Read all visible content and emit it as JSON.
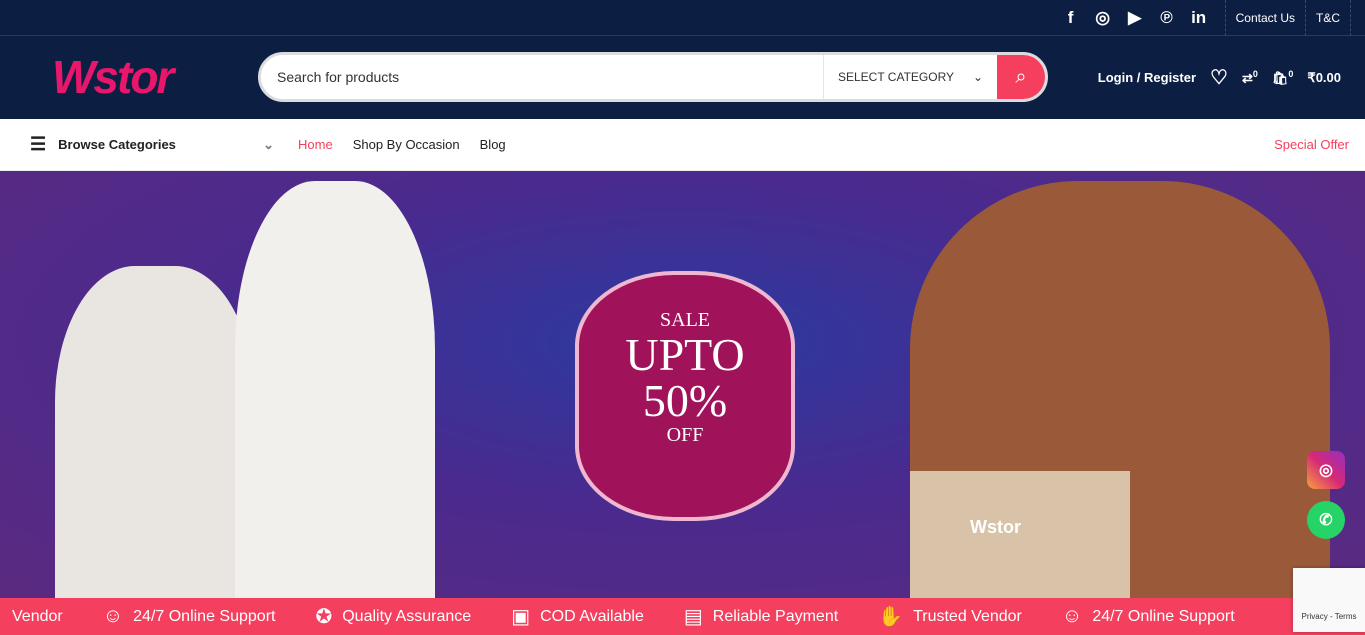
{
  "topbar": {
    "social": [
      "facebook-icon",
      "instagram-icon",
      "youtube-icon",
      "pinterest-icon",
      "linkedin-icon"
    ],
    "links": [
      "Contact Us",
      "T&C"
    ]
  },
  "header": {
    "logo": "Wstor",
    "search_placeholder": "Search for products",
    "category": "SELECT CATEGORY",
    "login": "Login / Register",
    "compare_count": "0",
    "cart_count": "0",
    "cart_total": "₹0.00"
  },
  "nav": {
    "browse": "Browse Categories",
    "items": [
      "Home",
      "Shop By Occasion",
      "Blog"
    ],
    "special": "Special Offer"
  },
  "hero": {
    "sale": "SALE",
    "upto": "UPTO",
    "percent": "50%",
    "off": "OFF",
    "bag_logo": "Wstor"
  },
  "features": [
    "Vendor",
    "24/7 Online Support",
    "Quality Assurance",
    "COD Available",
    "Reliable Payment",
    "Trusted Vendor",
    "24/7 Online Support"
  ],
  "recaptcha": "Privacy - Terms",
  "colors": {
    "navy": "#0c1f43",
    "accent": "#f43f5e",
    "logo": "#e8176b"
  }
}
